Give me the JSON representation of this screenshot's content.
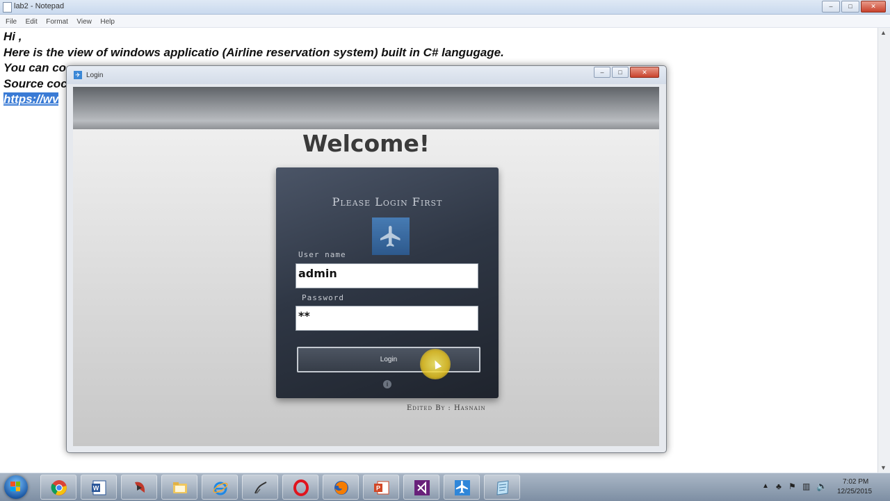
{
  "notepad": {
    "title": "lab2 - Notepad",
    "menu": [
      "File",
      "Edit",
      "Format",
      "View",
      "Help"
    ],
    "lines": [
      "Hi ,",
      "Here is the view of windows applicatio (Airline reservation system) built in C# langugage.",
      "You can co",
      "Source coc",
      "https://wv"
    ],
    "window_buttons": {
      "minimize": "–",
      "maximize": "□",
      "close": "✕"
    }
  },
  "login_window": {
    "title": "Login",
    "window_buttons": {
      "minimize": "–",
      "maximize": "□",
      "close": "✕"
    },
    "welcome": "Welcome!",
    "panel_title": "Please Login First",
    "username_label": "User name",
    "username_value": "admin",
    "password_label": "Password",
    "password_value": "**",
    "login_button": "Login",
    "info_icon": "i",
    "credit": "Edited By : Hasnain"
  },
  "taskbar": {
    "apps": [
      "start-orb",
      "chrome-icon",
      "word-icon",
      "media-icon",
      "folder-icon",
      "ie-icon",
      "inkscape-icon",
      "opera-icon",
      "firefox-icon",
      "powerpoint-icon",
      "visual-studio-icon",
      "airline-app-icon",
      "notepad-icon"
    ],
    "clock_time": "7:02 PM",
    "clock_date": "12/25/2015"
  },
  "colors": {
    "accent": "#3a7bd5",
    "panel": "#2f3745",
    "taskbar": "#8a9bb0"
  }
}
